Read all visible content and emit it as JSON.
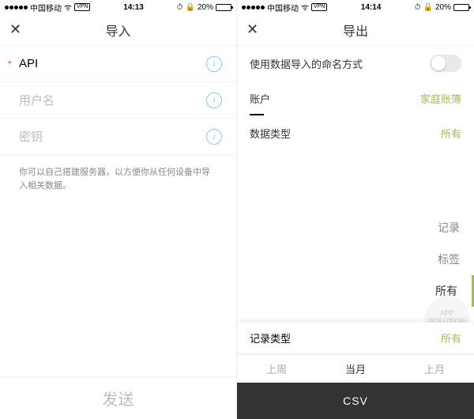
{
  "status": {
    "carrier": "中国移动",
    "vpn": "VPN",
    "time_left": "14:13",
    "time_right": "14:14",
    "battery": "20%"
  },
  "left": {
    "title": "导入",
    "fields": {
      "api": "API",
      "user": "用户名",
      "key": "密钥"
    },
    "hint": "你可以自己搭建服务器，以方便你从任何设备中导入相关数据。",
    "send": "发送"
  },
  "right": {
    "title": "导出",
    "naming_label": "使用数据导入的命名方式",
    "account_label": "账户",
    "account_value": "家庭账簿",
    "datatype_label": "数据类型",
    "datatype_value": "所有",
    "picker": [
      "记录",
      "标签",
      "所有"
    ],
    "record_type_label": "记录类型",
    "record_type_value": "所有",
    "tabs": [
      "上周",
      "当月",
      "上月"
    ],
    "csv": "CSV",
    "watermark1": "APP",
    "watermark2": "SOLUTION"
  }
}
